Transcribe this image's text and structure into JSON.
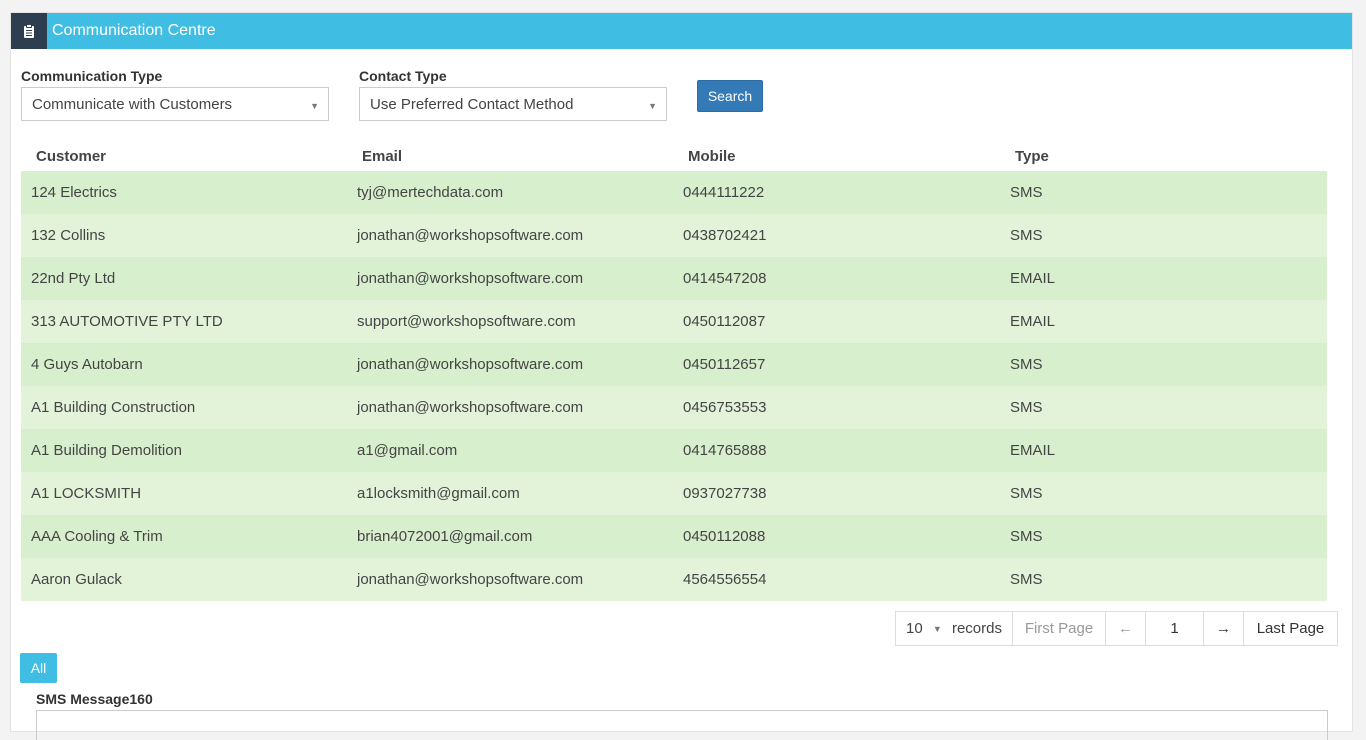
{
  "header": {
    "title": "Communication Centre",
    "icon": "clipboard-icon"
  },
  "filters": {
    "communication_type": {
      "label": "Communication Type",
      "value": "Communicate with Customers"
    },
    "contact_type": {
      "label": "Contact Type",
      "value": "Use Preferred Contact Method"
    },
    "search_label": "Search"
  },
  "table": {
    "headers": [
      "Customer",
      "Email",
      "Mobile",
      "Type"
    ],
    "rows": [
      [
        "124 Electrics",
        "tyj@mertechdata.com",
        "0444111222",
        "SMS"
      ],
      [
        "132 Collins",
        "jonathan@workshopsoftware.com",
        "0438702421",
        "SMS"
      ],
      [
        "22nd Pty Ltd",
        "jonathan@workshopsoftware.com",
        "0414547208",
        "EMAIL"
      ],
      [
        "313 AUTOMOTIVE PTY LTD",
        "support@workshopsoftware.com",
        "0450112087",
        "EMAIL"
      ],
      [
        "4 Guys Autobarn",
        "jonathan@workshopsoftware.com",
        "0450112657",
        "SMS"
      ],
      [
        "A1 Building Construction",
        "jonathan@workshopsoftware.com",
        "0456753553",
        "SMS"
      ],
      [
        "A1 Building Demolition",
        "a1@gmail.com",
        "0414765888",
        "EMAIL"
      ],
      [
        "A1 LOCKSMITH",
        "a1locksmith@gmail.com",
        "0937027738",
        "SMS"
      ],
      [
        "AAA Cooling & Trim",
        "brian4072001@gmail.com",
        "0450112088",
        "SMS"
      ],
      [
        "Aaron Gulack",
        "jonathan@workshopsoftware.com",
        "4564556554",
        "SMS"
      ]
    ]
  },
  "pager": {
    "page_size": "10",
    "records_label": "records",
    "first_label": "First Page",
    "prev_label": "←",
    "current_page": "1",
    "next_label": "→",
    "last_label": "Last Page"
  },
  "all_label": "All",
  "sms": {
    "label": "SMS Message160"
  }
}
